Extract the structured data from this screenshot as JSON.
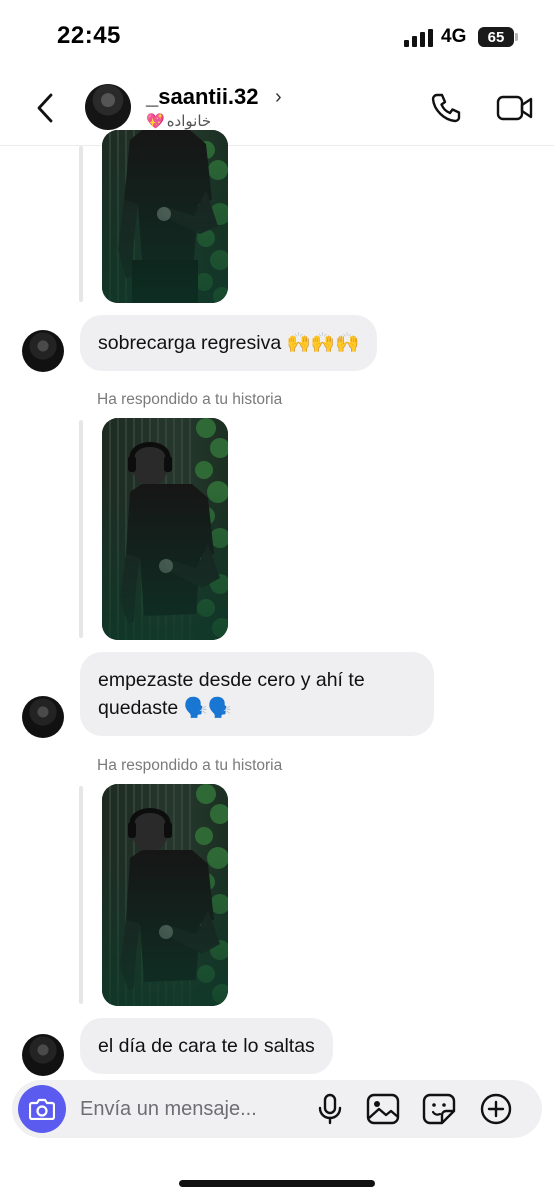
{
  "status_bar": {
    "time": "22:45",
    "network": "4G",
    "battery": "65"
  },
  "header": {
    "username": "_saantii.32",
    "subtitle": "خانواده",
    "subtitle_icon": "sparkling-heart-icon",
    "chevron": "›"
  },
  "messages": [
    {
      "type": "story_reply",
      "caption": ""
    },
    {
      "type": "text",
      "text": "sobrecarga regresiva 🙌🙌🙌"
    },
    {
      "type": "story_reply",
      "caption": "Ha respondido a tu historia"
    },
    {
      "type": "text",
      "text": "empezaste desde cero y ahí te quedaste 🗣️🗣️"
    },
    {
      "type": "story_reply",
      "caption": "Ha respondido a tu historia"
    },
    {
      "type": "text",
      "text": "el día de cara te lo saltas"
    }
  ],
  "composer": {
    "placeholder": "Envía un mensaje..."
  },
  "colors": {
    "camera_button": "#5b5bf0",
    "bubble": "#efeff1",
    "accent_heart": "#e0457b"
  }
}
